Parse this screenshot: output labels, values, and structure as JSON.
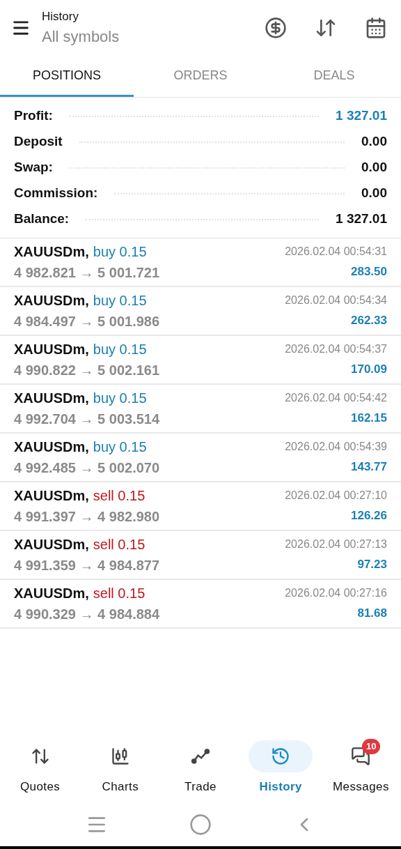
{
  "header": {
    "title": "History",
    "subtitle": "All symbols"
  },
  "tabs": [
    {
      "label": "POSITIONS",
      "selected": true
    },
    {
      "label": "ORDERS",
      "selected": false
    },
    {
      "label": "DEALS",
      "selected": false
    }
  ],
  "summary": [
    {
      "label": "Profit:",
      "value": "1 327.01",
      "highlight": true
    },
    {
      "label": "Deposit",
      "value": "0.00",
      "highlight": false
    },
    {
      "label": "Swap:",
      "value": "0.00",
      "highlight": false
    },
    {
      "label": "Commission:",
      "value": "0.00",
      "highlight": false
    },
    {
      "label": "Balance:",
      "value": "1 327.01",
      "highlight": false
    }
  ],
  "positions": [
    {
      "symbol": "XAUUSDm,",
      "side": "buy 0.15",
      "kind": "buy",
      "prices": "4 982.821 → 5 001.721",
      "time": "2026.02.04 00:54:31",
      "profit": "283.50"
    },
    {
      "symbol": "XAUUSDm,",
      "side": "buy 0.15",
      "kind": "buy",
      "prices": "4 984.497 → 5 001.986",
      "time": "2026.02.04 00:54:34",
      "profit": "262.33"
    },
    {
      "symbol": "XAUUSDm,",
      "side": "buy 0.15",
      "kind": "buy",
      "prices": "4 990.822 → 5 002.161",
      "time": "2026.02.04 00:54:37",
      "profit": "170.09"
    },
    {
      "symbol": "XAUUSDm,",
      "side": "buy 0.15",
      "kind": "buy",
      "prices": "4 992.704 → 5 003.514",
      "time": "2026.02.04 00:54:42",
      "profit": "162.15"
    },
    {
      "symbol": "XAUUSDm,",
      "side": "buy 0.15",
      "kind": "buy",
      "prices": "4 992.485 → 5 002.070",
      "time": "2026.02.04 00:54:39",
      "profit": "143.77"
    },
    {
      "symbol": "XAUUSDm,",
      "side": "sell 0.15",
      "kind": "sell",
      "prices": "4 991.397 → 4 982.980",
      "time": "2026.02.04 00:27:10",
      "profit": "126.26"
    },
    {
      "symbol": "XAUUSDm,",
      "side": "sell 0.15",
      "kind": "sell",
      "prices": "4 991.359 → 4 984.877",
      "time": "2026.02.04 00:27:13",
      "profit": "97.23"
    },
    {
      "symbol": "XAUUSDm,",
      "side": "sell 0.15",
      "kind": "sell",
      "prices": "4 990.329 → 4 984.884",
      "time": "2026.02.04 00:27:16",
      "profit": "81.68"
    }
  ],
  "bottom_nav": [
    {
      "label": "Quotes",
      "kind": "quotes",
      "selected": false
    },
    {
      "label": "Charts",
      "kind": "charts",
      "selected": false
    },
    {
      "label": "Trade",
      "kind": "trade",
      "selected": false
    },
    {
      "label": "History",
      "kind": "history",
      "selected": true
    },
    {
      "label": "Messages",
      "kind": "messages",
      "selected": false,
      "badge": "10"
    }
  ]
}
